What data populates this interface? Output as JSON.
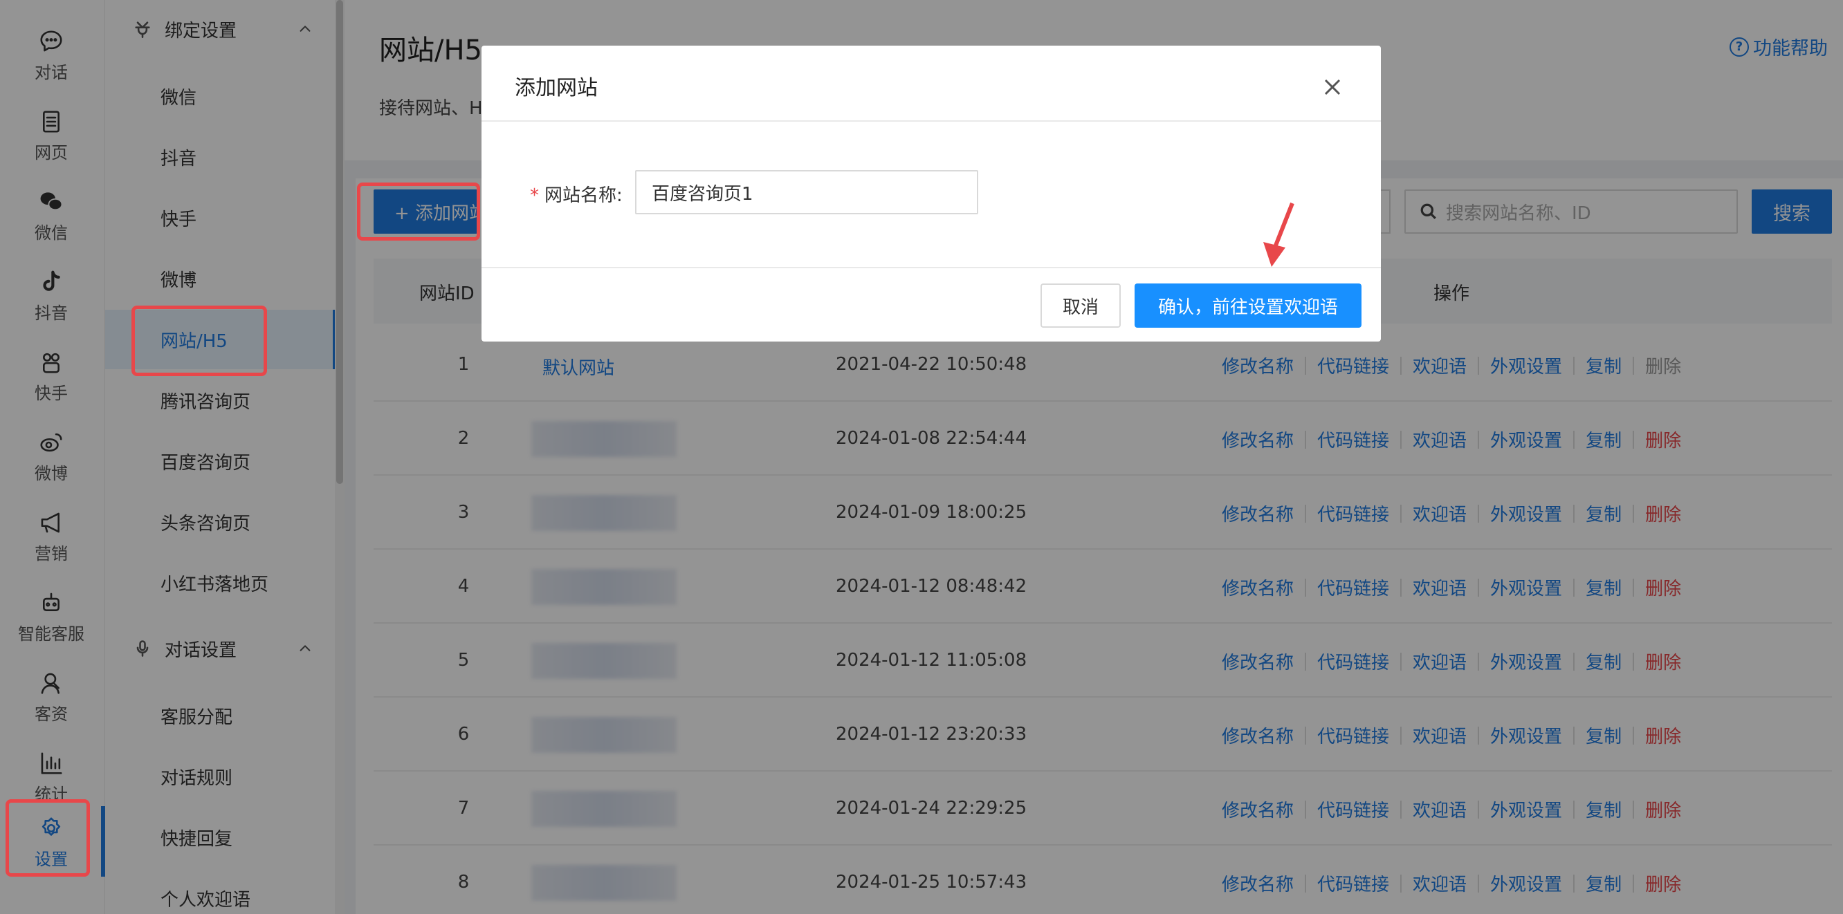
{
  "rail": {
    "items": [
      {
        "label": "对话",
        "icon": "chat-icon"
      },
      {
        "label": "网页",
        "icon": "document-icon"
      },
      {
        "label": "微信",
        "icon": "wechat-icon"
      },
      {
        "label": "抖音",
        "icon": "douyin-icon"
      },
      {
        "label": "快手",
        "icon": "kuaishou-icon"
      },
      {
        "label": "微博",
        "icon": "weibo-icon"
      },
      {
        "label": "营销",
        "icon": "megaphone-icon"
      },
      {
        "label": "智能客服",
        "icon": "robot-icon"
      },
      {
        "label": "客资",
        "icon": "customer-icon"
      },
      {
        "label": "统计",
        "icon": "chart-icon"
      },
      {
        "label": "设置",
        "icon": "gear-icon"
      }
    ]
  },
  "menu": {
    "groups": [
      {
        "title": "绑定设置",
        "items": [
          "微信",
          "抖音",
          "快手",
          "微博",
          "网站/H5",
          "腾讯咨询页",
          "百度咨询页",
          "头条咨询页",
          "小红书落地页"
        ]
      },
      {
        "title": "对话设置",
        "items": [
          "客服分配",
          "对话规则",
          "快捷回复",
          "个人欢迎语"
        ]
      }
    ]
  },
  "page": {
    "title": "网站/H5",
    "desc": "接待网站、H",
    "help": "功能帮助",
    "add_button": "+ 添加网站",
    "search_placeholder": "搜索网站名称、ID",
    "search_button": "搜索"
  },
  "table": {
    "headers": {
      "id": "网站ID",
      "ops": "操作"
    },
    "rows": [
      {
        "id": "1",
        "name": "默认网站",
        "time": "2021-04-22 10:50:48"
      },
      {
        "id": "2",
        "name": "",
        "time": "2024-01-08 22:54:44"
      },
      {
        "id": "3",
        "name": "",
        "time": "2024-01-09 18:00:25"
      },
      {
        "id": "4",
        "name": "",
        "time": "2024-01-12 08:48:42"
      },
      {
        "id": "5",
        "name": "",
        "time": "2024-01-12 11:05:08"
      },
      {
        "id": "6",
        "name": "",
        "time": "2024-01-12 23:20:33"
      },
      {
        "id": "7",
        "name": "",
        "time": "2024-01-24 22:29:25"
      },
      {
        "id": "8",
        "name": "",
        "time": "2024-01-25 10:57:43"
      }
    ],
    "ops": {
      "rename": "修改名称",
      "code": "代码链接",
      "welcome": "欢迎语",
      "appearance": "外观设置",
      "copy": "复制",
      "delete": "删除"
    }
  },
  "modal": {
    "title": "添加网站",
    "field_required": "*",
    "field_label": "网站名称:",
    "field_value": "百度咨询页1",
    "cancel": "取消",
    "confirm": "确认，前往设置欢迎语"
  },
  "colors": {
    "accent": "#1f7ae0",
    "danger": "#e8474a",
    "highlight": "#e8474a"
  }
}
